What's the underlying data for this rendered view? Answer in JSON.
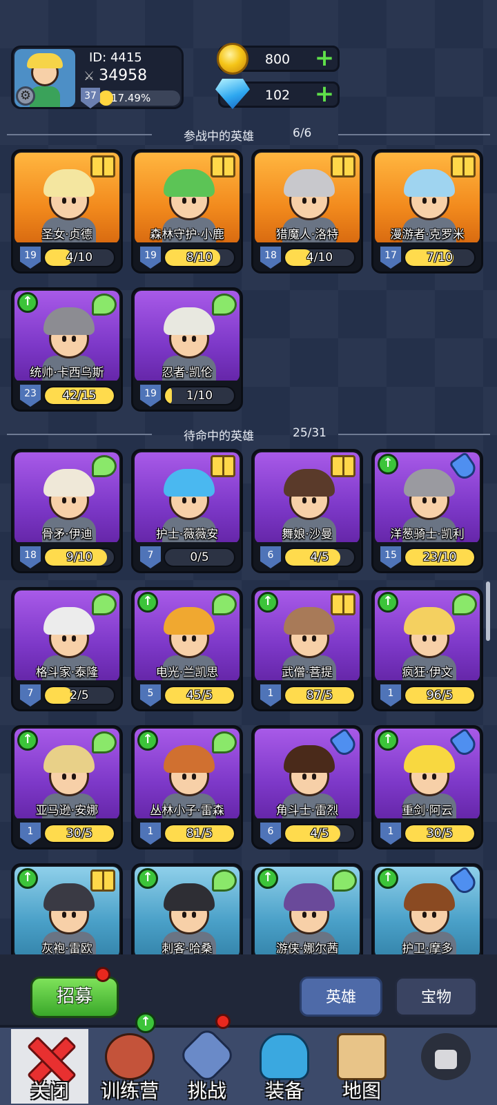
{
  "player": {
    "id_text": "ID: 4415",
    "power": "34958",
    "level": "37",
    "xp_percent": "17.49%",
    "xp_fraction": 0.1749
  },
  "currency": {
    "gold": "800",
    "gems": "102"
  },
  "active_section": {
    "title": "参战中的英雄",
    "count": "6/6"
  },
  "standby_section": {
    "title": "待命中的英雄",
    "count": "25/31"
  },
  "active_heroes": [
    {
      "name": "圣女·贞德",
      "level": "19",
      "progress": "4/10",
      "fill": 0.4,
      "bg": "orange",
      "badge": "book",
      "up": false,
      "hair": "#f4e6a0"
    },
    {
      "name": "森林守护·小鹿",
      "level": "19",
      "progress": "8/10",
      "fill": 0.8,
      "bg": "orange",
      "badge": "book",
      "up": false,
      "hair": "#5cc456"
    },
    {
      "name": "猎魔人·洛特",
      "level": "18",
      "progress": "4/10",
      "fill": 0.4,
      "bg": "orange",
      "badge": "book",
      "up": false,
      "hair": "#c8c8cc"
    },
    {
      "name": "漫游者·克罗米",
      "level": "17",
      "progress": "7/10",
      "fill": 0.7,
      "bg": "orange",
      "badge": "book",
      "up": false,
      "hair": "#9fd4f0"
    },
    {
      "name": "统帅·卡西乌斯",
      "level": "23",
      "progress": "42/15",
      "fill": 1.0,
      "bg": "purple",
      "badge": "wing",
      "up": true,
      "hair": "#8c8c92"
    },
    {
      "name": "忍者·凯伦",
      "level": "19",
      "progress": "1/10",
      "fill": 0.1,
      "bg": "purple",
      "badge": "wing",
      "up": false,
      "hair": "#e8e8e0"
    }
  ],
  "standby_heroes": [
    {
      "name": "骨矛·伊迪",
      "level": "18",
      "progress": "9/10",
      "fill": 0.9,
      "bg": "purple",
      "badge": "wing",
      "up": false,
      "hair": "#efe8d8"
    },
    {
      "name": "护士·薇薇安",
      "level": "7",
      "progress": "0/5",
      "fill": 0.0,
      "bg": "purple",
      "badge": "book",
      "up": false,
      "hair": "#4ab8f0"
    },
    {
      "name": "舞娘·沙曼",
      "level": "6",
      "progress": "4/5",
      "fill": 0.8,
      "bg": "purple",
      "badge": "book",
      "up": false,
      "hair": "#5a3a2a"
    },
    {
      "name": "洋葱骑士·凯利",
      "level": "15",
      "progress": "23/10",
      "fill": 1.0,
      "bg": "purple",
      "badge": "potion",
      "up": true,
      "hair": "#9a9aa0"
    },
    {
      "name": "格斗家·泰隆",
      "level": "7",
      "progress": "2/5",
      "fill": 0.4,
      "bg": "purple",
      "badge": "wing",
      "up": false,
      "hair": "#ececec"
    },
    {
      "name": "电光·兰凯思",
      "level": "5",
      "progress": "45/5",
      "fill": 1.0,
      "bg": "purple",
      "badge": "wing",
      "up": true,
      "hair": "#f0a830"
    },
    {
      "name": "武僧·菩提",
      "level": "1",
      "progress": "87/5",
      "fill": 1.0,
      "bg": "purple",
      "badge": "book",
      "up": true,
      "hair": "#a87a58"
    },
    {
      "name": "疯狂·伊文",
      "level": "1",
      "progress": "96/5",
      "fill": 1.0,
      "bg": "purple",
      "badge": "wing",
      "up": true,
      "hair": "#f4d060"
    },
    {
      "name": "亚马逊·安娜",
      "level": "1",
      "progress": "30/5",
      "fill": 1.0,
      "bg": "purple",
      "badge": "wing",
      "up": true,
      "hair": "#e8d088"
    },
    {
      "name": "丛林小子·雷森",
      "level": "1",
      "progress": "81/5",
      "fill": 1.0,
      "bg": "purple",
      "badge": "wing",
      "up": true,
      "hair": "#d07030"
    },
    {
      "name": "角斗士·雷烈",
      "level": "6",
      "progress": "4/5",
      "fill": 0.8,
      "bg": "purple",
      "badge": "potion",
      "up": false,
      "hair": "#4a2a1a"
    },
    {
      "name": "重剑·阿云",
      "level": "1",
      "progress": "30/5",
      "fill": 1.0,
      "bg": "purple",
      "badge": "potion",
      "up": true,
      "hair": "#f8d840"
    },
    {
      "name": "灰袍·雷欧",
      "level": "",
      "progress": "",
      "fill": 0,
      "bg": "teal",
      "badge": "book",
      "up": true,
      "hair": "#3a3a44"
    },
    {
      "name": "刺客·哈桑",
      "level": "",
      "progress": "",
      "fill": 0,
      "bg": "teal",
      "badge": "wing",
      "up": true,
      "hair": "#2e2e34"
    },
    {
      "name": "游侠·娜尔茜",
      "level": "",
      "progress": "",
      "fill": 0,
      "bg": "teal",
      "badge": "wing",
      "up": true,
      "hair": "#6a4a9a"
    },
    {
      "name": "护卫·摩多",
      "level": "",
      "progress": "",
      "fill": 0,
      "bg": "teal",
      "badge": "potion",
      "up": true,
      "hair": "#8a4a22"
    }
  ],
  "recruit_label": "招募",
  "tabs": {
    "heroes": "英雄",
    "treasure": "宝物"
  },
  "nav": {
    "close": "关闭",
    "camp": "训练营",
    "challenge": "挑战",
    "equip": "装备",
    "map": "地图"
  }
}
